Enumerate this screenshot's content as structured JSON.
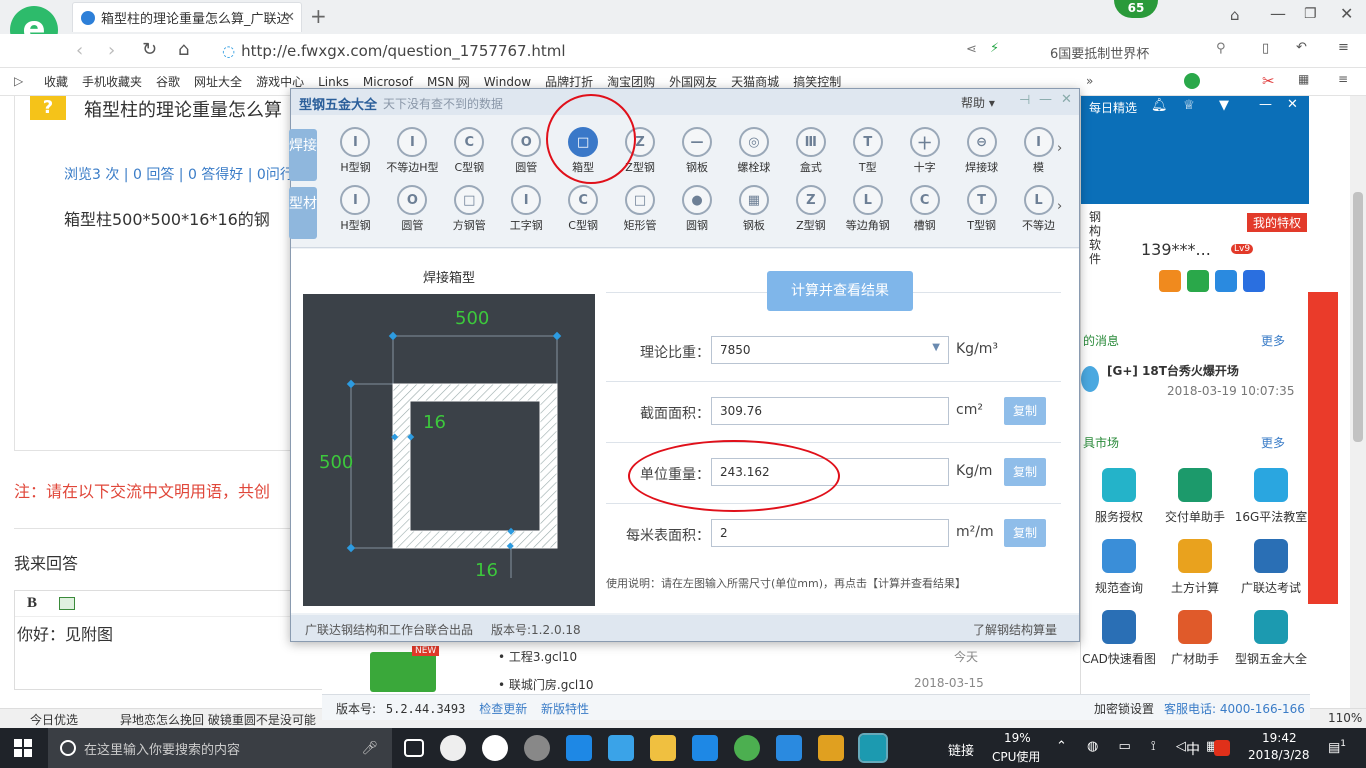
{
  "browser": {
    "tab_title": "箱型柱的理论重量怎么算_广联达",
    "badge": "65",
    "url": "http://e.fwxgx.com/question_1757767.html",
    "search_text": "6国要抵制世界杯",
    "bookmarks": [
      "收藏",
      "手机收藏夹",
      "谷歌",
      "网址大全",
      "游戏中心",
      "Links",
      "Microsof",
      "MSN 网",
      "Window",
      "品牌打折",
      "淘宝团购",
      "外国网友",
      "天猫商城",
      "搞笑控制"
    ]
  },
  "page": {
    "question_title": "箱型柱的理论重量怎么算",
    "meta": "浏览3 次 | 0 回答 | 0 答得好 | 0问行",
    "question_body": "箱型柱500*500*16*16的钢",
    "notice": "注：请在以下交流中文明用语，共创",
    "reply_heading": "我来回答",
    "editor_bold": "B",
    "reply_text": "你好：见附图"
  },
  "app": {
    "title": "型钢五金大全",
    "subtitle": "天下没有查不到的数据",
    "help": "帮助",
    "cat1": "焊接",
    "cat2": "型材",
    "row1": [
      {
        "label": "H型钢",
        "icon": "I"
      },
      {
        "label": "不等边H型",
        "icon": "I"
      },
      {
        "label": "C型钢",
        "icon": "C"
      },
      {
        "label": "圆管",
        "icon": "O"
      },
      {
        "label": "箱型",
        "icon": "□"
      },
      {
        "label": "Z型钢",
        "icon": "Z"
      },
      {
        "label": "钢板",
        "icon": "—"
      },
      {
        "label": "螺栓球",
        "icon": "◎"
      },
      {
        "label": "盒式",
        "icon": "Ⅲ"
      },
      {
        "label": "T型",
        "icon": "T"
      },
      {
        "label": "十字",
        "icon": "十"
      },
      {
        "label": "焊接球",
        "icon": "⊖"
      },
      {
        "label": "模",
        "icon": "I"
      }
    ],
    "row2": [
      {
        "label": "H型钢",
        "icon": "I"
      },
      {
        "label": "圆管",
        "icon": "O"
      },
      {
        "label": "方钢管",
        "icon": "□"
      },
      {
        "label": "工字钢",
        "icon": "I"
      },
      {
        "label": "C型钢",
        "icon": "C"
      },
      {
        "label": "矩形管",
        "icon": "□"
      },
      {
        "label": "圆钢",
        "icon": "●"
      },
      {
        "label": "钢板",
        "icon": "▦"
      },
      {
        "label": "Z型钢",
        "icon": "Z"
      },
      {
        "label": "等边角钢",
        "icon": "L"
      },
      {
        "label": "槽钢",
        "icon": "C"
      },
      {
        "label": "T型钢",
        "icon": "T"
      },
      {
        "label": "不等边",
        "icon": "L"
      }
    ],
    "diagram_title": "焊接箱型",
    "dim_top": "500",
    "dim_left": "500",
    "dim_web": "16",
    "dim_flange": "16",
    "calc_button": "计算并查看结果",
    "density_label": "理论比重：",
    "density_value": "7850",
    "density_unit": "Kg/m³",
    "area_label": "截面面积：",
    "area_value": "309.76",
    "area_unit": "cm²",
    "weight_label": "单位重量：",
    "weight_value": "243.162",
    "weight_unit": "Kg/m",
    "surface_label": "每米表面积：",
    "surface_value": "2",
    "surface_unit": "m²/m",
    "copy_label": "复制",
    "usage": "使用说明：请在左图输入所需尺寸(单位mm)，再点击【计算并查看结果】",
    "footer_left": "广联达钢结构和工作台联合出品",
    "version": "版本号:1.2.0.18",
    "footer_right": "了解钢结构算量"
  },
  "panel": {
    "title": "每日精选",
    "brand": "钢构软件",
    "privilege": "我的特权",
    "user": "139***...",
    "level": "Lv9",
    "messages_title": "的消息",
    "more": "更多",
    "message": "[G+] 18T台秀火爆开场",
    "message_time": "2018-03-19 10:07:35",
    "market_title": "具市场",
    "tiles": [
      {
        "label": "服务授权",
        "color": "#24b3c9"
      },
      {
        "label": "交付单助手",
        "color": "#1c9a6b"
      },
      {
        "label": "16G平法教室",
        "color": "#2aa6e0"
      },
      {
        "label": "规范查询",
        "color": "#3a8ed8"
      },
      {
        "label": "土方计算",
        "color": "#e9a21e"
      },
      {
        "label": "广联达考试",
        "color": "#2a6fb5"
      },
      {
        "label": "CAD快速看图",
        "color": "#2a6fb5"
      },
      {
        "label": "广材助手",
        "color": "#e05a2a"
      },
      {
        "label": "型钢五金大全",
        "color": "#1c9ab0"
      }
    ]
  },
  "client": {
    "version_label": "版本号:",
    "version": "5.2.44.3493",
    "check_update": "检查更新",
    "new_features": "新版特性",
    "lock": "加密锁设置",
    "hotline": "客服电话: 4000-166-166",
    "files": [
      {
        "name": "工程3.gcl10",
        "time": "今天"
      },
      {
        "name": "联城门房.gcl10",
        "time": "2018-03-15"
      }
    ],
    "new_badge": "NEW"
  },
  "statusbar": {
    "today": "今日优选",
    "news": "异地恋怎么挽回 破镜重圆不是没可能",
    "zoom": "110%"
  },
  "taskbar": {
    "search_placeholder": "在这里输入你要搜索的内容",
    "link": "链接",
    "cpu": "19%",
    "cpu_label": "CPU使用",
    "ime": "中",
    "time": "19:42",
    "date": "2018/3/28",
    "notify": "1"
  }
}
